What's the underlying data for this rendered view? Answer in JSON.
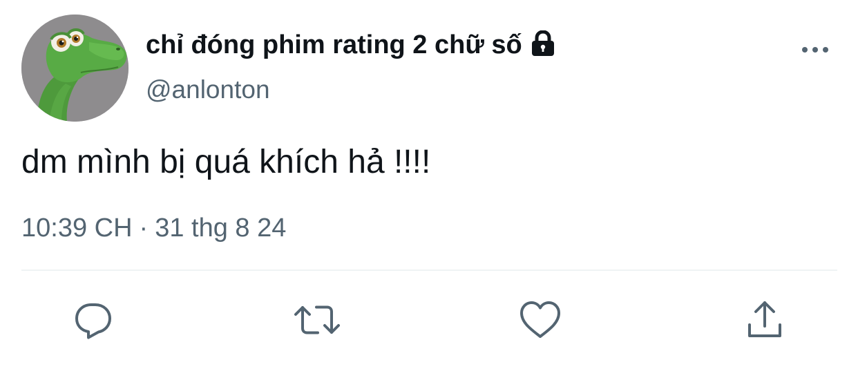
{
  "tweet": {
    "display_name": "chỉ đóng phim rating 2 chữ số",
    "handle": "@anlonton",
    "text": "dm mình bị quá khích hả !!!!",
    "time": "10:39 CH",
    "separator": "·",
    "date": "31 thg 8 24",
    "protected": true
  },
  "icons": {
    "lock": "lock-icon",
    "more": "more-horizontal-icon",
    "reply": "reply-icon",
    "retweet": "retweet-icon",
    "like": "heart-icon",
    "share": "share-icon"
  },
  "colors": {
    "text_primary": "#0f1419",
    "text_secondary": "#536471",
    "icon": "#536471",
    "divider": "#eff3f4",
    "background": "#ffffff"
  }
}
